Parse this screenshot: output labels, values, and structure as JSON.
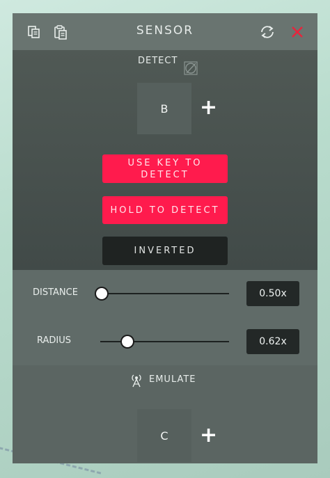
{
  "header": {
    "title": "SENSOR",
    "icons": [
      "copy-icon",
      "paste-icon",
      "refresh-icon",
      "close-icon"
    ],
    "close_color": "#e8243c"
  },
  "detect": {
    "label": "DETECT",
    "key": "B",
    "add": "+",
    "buttons": {
      "use_key": "USE KEY TO DETECT",
      "hold": "HOLD TO DETECT",
      "inverted": "INVERTED"
    }
  },
  "sliders": {
    "distance": {
      "label": "DISTANCE",
      "value": "0.50x",
      "level": 0
    },
    "radius": {
      "label": "RADIUS",
      "value": "0.62x",
      "level": 0.2
    }
  },
  "emulate": {
    "label": "EMULATE",
    "key": "C",
    "add": "+"
  },
  "colors": {
    "accent_red": "#ff1b4d",
    "panel": "#4a5552",
    "header": "#697470"
  }
}
